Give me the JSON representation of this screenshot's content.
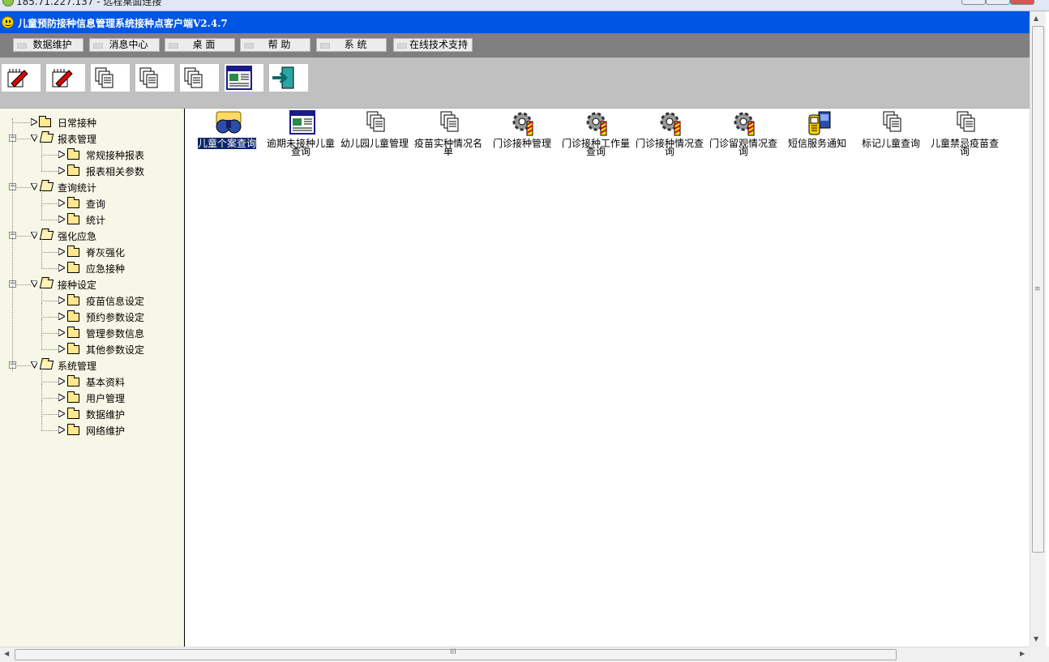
{
  "rdp": {
    "title": "185.71.227.137 - 远程桌面连接"
  },
  "app": {
    "title": "儿童预防接种信息管理系统接种点客户端V2.4.7"
  },
  "menu": [
    {
      "label": "数据维护"
    },
    {
      "label": "消息中心"
    },
    {
      "label": "桌 面"
    },
    {
      "label": "帮 助"
    },
    {
      "label": "系 统"
    },
    {
      "label": "在线技术支持"
    }
  ],
  "toolbar": [
    {
      "icon": "pencil-notebook-icon"
    },
    {
      "icon": "pencil-notebook-icon"
    },
    {
      "icon": "documents-icon"
    },
    {
      "icon": "documents-icon"
    },
    {
      "icon": "documents-icon"
    },
    {
      "icon": "window-list-icon"
    },
    {
      "icon": "exit-door-icon"
    }
  ],
  "collapse_glyph": "<=",
  "tree": {
    "groups": [
      {
        "label": "日常接种",
        "expanded": false,
        "children": []
      },
      {
        "label": "报表管理",
        "expanded": true,
        "children": [
          {
            "label": "常规接种报表"
          },
          {
            "label": "报表相关参数"
          }
        ]
      },
      {
        "label": "查询统计",
        "expanded": true,
        "children": [
          {
            "label": "查询"
          },
          {
            "label": "统计"
          }
        ]
      },
      {
        "label": "强化应急",
        "expanded": true,
        "children": [
          {
            "label": "脊灰强化"
          },
          {
            "label": "应急接种"
          }
        ]
      },
      {
        "label": "接种设定",
        "expanded": true,
        "children": [
          {
            "label": "疫苗信息设定"
          },
          {
            "label": "预约参数设定"
          },
          {
            "label": "管理参数信息"
          },
          {
            "label": "其他参数设定"
          }
        ]
      },
      {
        "label": "系统管理",
        "expanded": true,
        "children": [
          {
            "label": "基本资料"
          },
          {
            "label": "用户管理"
          },
          {
            "label": "数据维护"
          },
          {
            "label": "网络维护"
          }
        ]
      }
    ]
  },
  "main_items": [
    {
      "label": "儿童个案查询",
      "icon": "binoculars-icon",
      "selected": true
    },
    {
      "label": "逾期未接种儿童查询",
      "icon": "window-list-icon",
      "selected": false
    },
    {
      "label": "幼儿园儿童管理",
      "icon": "documents-icon",
      "selected": false
    },
    {
      "label": "疫苗实种情况名单",
      "icon": "documents-icon",
      "selected": false
    },
    {
      "label": "门诊接种管理",
      "icon": "gear-icon",
      "selected": false
    },
    {
      "label": "门诊接种工作量查询",
      "icon": "gear-icon",
      "selected": false
    },
    {
      "label": "门诊接种情况查询",
      "icon": "gear-icon",
      "selected": false
    },
    {
      "label": "门诊留观情况查询",
      "icon": "gear-icon",
      "selected": false
    },
    {
      "label": "短信服务通知",
      "icon": "mobile-phone-icon",
      "selected": false
    },
    {
      "label": "标记儿童查询",
      "icon": "documents-icon",
      "selected": false
    },
    {
      "label": "儿童禁忌疫苗查询",
      "icon": "documents-icon",
      "selected": false
    }
  ],
  "scroll": {
    "h_grip": "III",
    "v_grip": "≡"
  }
}
